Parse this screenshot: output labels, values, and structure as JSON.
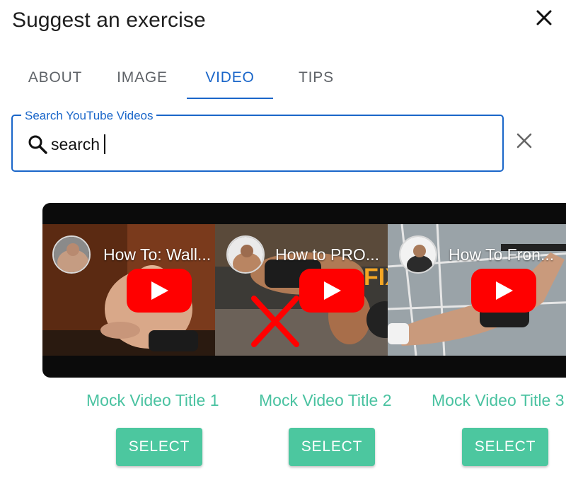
{
  "dialog": {
    "title": "Suggest an exercise",
    "close_icon": "close-icon"
  },
  "tabs": [
    {
      "label": "ABOUT",
      "active": false
    },
    {
      "label": "IMAGE",
      "active": false
    },
    {
      "label": "VIDEO",
      "active": true
    },
    {
      "label": "TIPS",
      "active": false
    }
  ],
  "search": {
    "label": "Search YouTube Videos",
    "value": "search",
    "icon": "search-icon",
    "clear_icon": "clear-icon"
  },
  "videos": [
    {
      "thumb_title": "How To: Wall...",
      "title": "Mock Video Title 1",
      "select_label": "SELECT"
    },
    {
      "thumb_title": "How to PRO...",
      "title": "Mock Video Title 2",
      "select_label": "SELECT",
      "thumb_text": "FIX"
    },
    {
      "thumb_title": "How To Fron...",
      "title": "Mock Video Title 3",
      "select_label": "SELECT"
    }
  ],
  "colors": {
    "accent_blue": "#1a66c9",
    "teal_text": "#49c2a0",
    "select_button": "#4cc79f",
    "youtube_red": "#ff0000"
  }
}
